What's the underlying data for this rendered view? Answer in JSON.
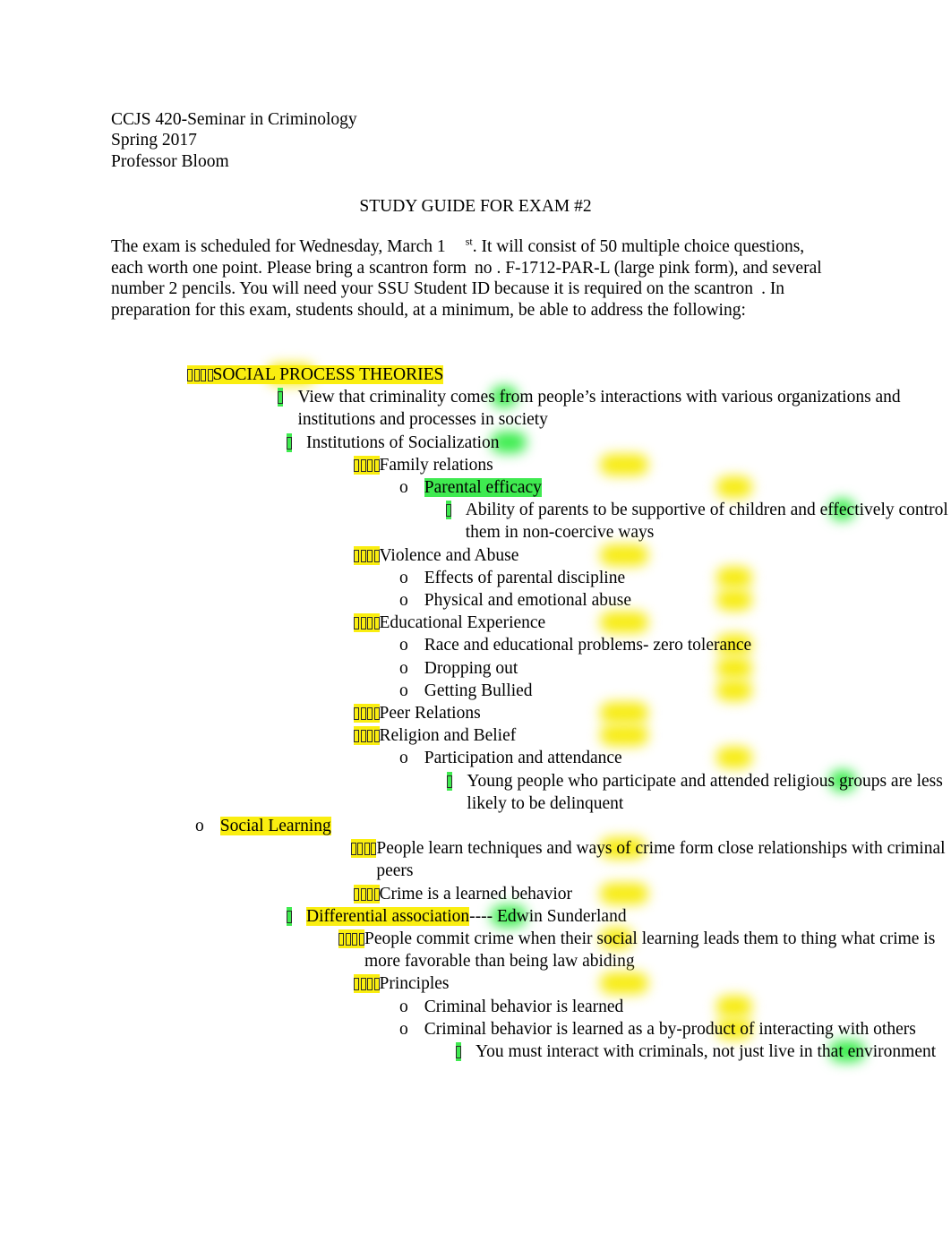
{
  "header": {
    "course": "CCJS 420-Seminar in Criminology",
    "term": "Spring 2017",
    "instructor": "Professor Bloom"
  },
  "title": "STUDY GUIDE FOR EXAM #2",
  "intro": {
    "part1": "The exam is scheduled for Wednesday, March 1",
    "superscript": "st",
    "part2": ".  It will consist of 50 multiple choice questions, each worth one point. Please bring a scantron form",
    "part3": "no",
    "part4": ". F-1712-PAR-L (large pink form),  and several number 2 pencils. You will need your SSU Student ID because it is required on the scantron",
    "part5": ". In preparation for this exam, students should, at a minimum, be able to address the following:"
  },
  "colors": {
    "yellow_highlight": "#faee10",
    "green_highlight": "#3fea50",
    "text": "#000000"
  },
  "outline": [
    {
      "id": "social-process-theories",
      "level": 1,
      "marker": "tofu4",
      "marker_hl": "yellow",
      "text": "SOCIAL PROCESS THEORIES",
      "text_hl": "yellow"
    },
    {
      "id": "view-criminality",
      "level": 2,
      "marker": "tofu1",
      "marker_hl": "green",
      "text": "View that criminality comes from people’s interactions with various organizations and institutions and processes in society",
      "text_hl": "none"
    },
    {
      "id": "institutions-socialization",
      "level": 2,
      "marker": "tofu1",
      "marker_hl": "green",
      "text": "Institutions of Socialization",
      "text_hl": "none"
    },
    {
      "id": "family-relations",
      "level": 3,
      "marker": "tofu4",
      "marker_hl": "yellow",
      "text": "Family relations",
      "text_hl": "none"
    },
    {
      "id": "parental-efficacy",
      "level": 4,
      "marker": "o",
      "marker_hl": "yellow",
      "text": "Parental efficacy",
      "text_hl": "green"
    },
    {
      "id": "ability-of-parents",
      "level": 5,
      "marker": "tofu1",
      "marker_hl": "green",
      "text": "Ability of parents to be supportive of children and effectively control them in non-coercive ways",
      "text_hl": "none"
    },
    {
      "id": "violence-and-abuse",
      "level": 3,
      "marker": "tofu4",
      "marker_hl": "yellow",
      "text": "Violence and Abuse",
      "text_hl": "none"
    },
    {
      "id": "effects-parental-discipline",
      "level": 4,
      "marker": "o",
      "marker_hl": "yellow",
      "text": "Effects of parental discipline",
      "text_hl": "none"
    },
    {
      "id": "physical-emotional-abuse",
      "level": 4,
      "marker": "o",
      "marker_hl": "yellow",
      "text": "Physical and emotional abuse",
      "text_hl": "none"
    },
    {
      "id": "educational-experience",
      "level": 3,
      "marker": "tofu4",
      "marker_hl": "yellow",
      "text": "Educational Experience",
      "text_hl": "none"
    },
    {
      "id": "race-educational-problems",
      "level": 4,
      "marker": "o",
      "marker_hl": "yellow",
      "text": "Race and educational problems- zero tolerance",
      "text_hl": "none"
    },
    {
      "id": "dropping-out",
      "level": 4,
      "marker": "o",
      "marker_hl": "yellow",
      "text": "Dropping out",
      "text_hl": "none"
    },
    {
      "id": "getting-bullied",
      "level": 4,
      "marker": "o",
      "marker_hl": "yellow",
      "text": "Getting Bullied",
      "text_hl": "none"
    },
    {
      "id": "peer-relations",
      "level": 3,
      "marker": "tofu4",
      "marker_hl": "yellow",
      "text": "Peer Relations",
      "text_hl": "none"
    },
    {
      "id": "religion-and-belief",
      "level": 3,
      "marker": "tofu4",
      "marker_hl": "yellow",
      "text": "Religion and Belief",
      "text_hl": "none"
    },
    {
      "id": "participation-attendance",
      "level": 4,
      "marker": "o",
      "marker_hl": "yellow",
      "text": "Participation and attendance",
      "text_hl": "none"
    },
    {
      "id": "young-people-religious",
      "level": 5,
      "marker": "tofu1",
      "marker_hl": "green",
      "text": "Young people who participate and attended religious groups are less likely to be delinquent",
      "text_hl": "none"
    },
    {
      "id": "social-learning",
      "level": 0,
      "marker": "o",
      "marker_hl": "none",
      "text": "Social Learning",
      "text_hl": "yellow"
    },
    {
      "id": "people-learn-techniques",
      "level": 3,
      "marker": "tofu4",
      "marker_hl": "yellow",
      "text": "People learn techniques and ways of crime form close relationships with criminal peers",
      "text_hl": "none"
    },
    {
      "id": "crime-learned-behavior",
      "level": 3,
      "marker": "tofu4",
      "marker_hl": "yellow",
      "text": "Crime is a learned behavior",
      "text_hl": "none"
    },
    {
      "id": "differential-association",
      "level": 2,
      "marker": "tofu1",
      "marker_hl": "green",
      "text": "Differential association",
      "text_hl": "yellow",
      "text_suffix": "---- Edwin Sunderland"
    },
    {
      "id": "people-commit-crime",
      "level": 3,
      "marker": "tofu4",
      "marker_hl": "yellow",
      "text": "People commit crime when their social learning leads them to thing what crime is more favorable than being law abiding",
      "text_hl": "none"
    },
    {
      "id": "principles",
      "level": 3,
      "marker": "tofu4",
      "marker_hl": "yellow",
      "text": "Principles",
      "text_hl": "none"
    },
    {
      "id": "criminal-behavior-learned",
      "level": 4,
      "marker": "o",
      "marker_hl": "yellow",
      "text": "Criminal behavior is learned",
      "text_hl": "none"
    },
    {
      "id": "criminal-behavior-byproduct",
      "level": 4,
      "marker": "o",
      "marker_hl": "yellow",
      "text": "Criminal behavior is learned as a by-product of interacting with others",
      "text_hl": "none"
    },
    {
      "id": "must-interact-criminals",
      "level": 5,
      "marker": "tofu1",
      "marker_hl": "green",
      "text": "You must interact with criminals, not just live in that environment",
      "text_hl": "none"
    }
  ]
}
